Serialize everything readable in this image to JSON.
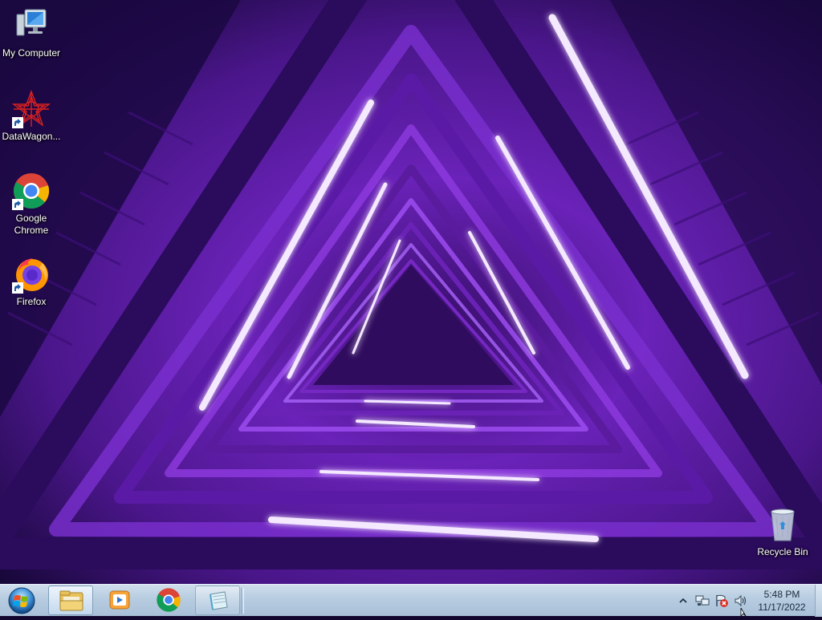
{
  "desktop": {
    "icons": [
      {
        "id": "my-computer",
        "label": "My Computer"
      },
      {
        "id": "datawagon",
        "label": "DataWagon..."
      },
      {
        "id": "google-chrome",
        "label": "Google Chrome"
      },
      {
        "id": "firefox",
        "label": "Firefox"
      },
      {
        "id": "recycle-bin",
        "label": "Recycle Bin"
      }
    ]
  },
  "taskbar": {
    "start_icon": "windows-start-orb",
    "pinned": [
      {
        "name": "file-explorer",
        "state": "active"
      },
      {
        "name": "media-player",
        "state": "pinned"
      },
      {
        "name": "google-chrome",
        "state": "pinned"
      },
      {
        "name": "notepad",
        "state": "running"
      }
    ],
    "tray": {
      "icons": [
        "show-hidden-icons-chevron",
        "network-icon",
        "action-center-flag-error-icon",
        "volume-icon"
      ],
      "time": "5:48 PM",
      "date": "11/17/2022"
    }
  },
  "colors": {
    "accent": "#9b3bff",
    "wallpaper_base": "#2a0a5e",
    "taskbar": "#b7cce0"
  }
}
